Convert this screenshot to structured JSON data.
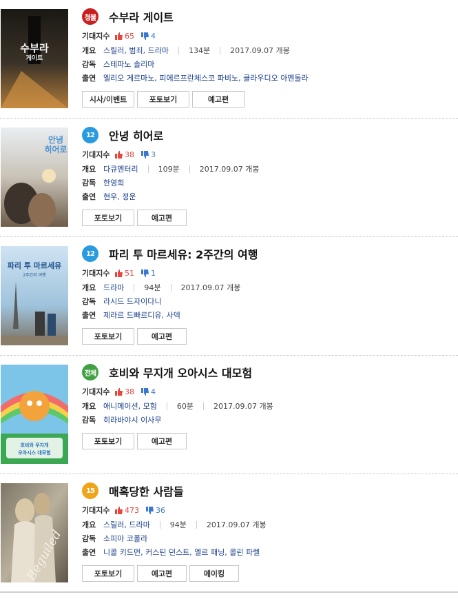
{
  "labels": {
    "expectation": "기대지수",
    "overview": "개요",
    "director": "감독",
    "cast": "출연"
  },
  "movies": [
    {
      "badge": "청불",
      "badge_color": "#c8201f",
      "title": "수부라 게이트",
      "likes": "65",
      "dislikes": "4",
      "genres": "스릴러, 범죄, 드라마",
      "runtime": "134분",
      "release": "2017.09.07 개봉",
      "director": "스테파노 솔리마",
      "cast": "엘리오 게르마노, 피에르프란체스코 파비노, 클라우디오 아멘돌라",
      "buttons": [
        "시사/이벤트",
        "포토보기",
        "예고편"
      ],
      "poster_title": "수부라\n게이트"
    },
    {
      "badge": "12",
      "badge_color": "#2a9be0",
      "title": "안녕 히어로",
      "likes": "38",
      "dislikes": "3",
      "genres": "다큐멘터리",
      "runtime": "109분",
      "release": "2017.09.07 개봉",
      "director": "한영희",
      "cast": "현우, 정운",
      "buttons": [
        "포토보기",
        "예고편"
      ],
      "poster_title": "안녕\n히어로"
    },
    {
      "badge": "12",
      "badge_color": "#2a9be0",
      "title": "파리 투 마르세유: 2주간의 여행",
      "likes": "51",
      "dislikes": "1",
      "genres": "드라마",
      "runtime": "94분",
      "release": "2017.09.07 개봉",
      "director": "라시드 드자이다니",
      "cast": "제라르 드빠르디유, 사덱",
      "buttons": [
        "포토보기",
        "예고편"
      ],
      "poster_title": "파리 투 마르세유"
    },
    {
      "badge": "전체",
      "badge_color": "#3fa142",
      "title": "호비와 무지개 오아시스 대모험",
      "likes": "38",
      "dislikes": "4",
      "genres": "애니메이션, 모험",
      "runtime": "60분",
      "release": "2017.09.07 개봉",
      "director": "히라바야시 이사무",
      "cast": null,
      "buttons": [
        "포토보기",
        "예고편"
      ],
      "poster_title": "호비와 무지개\n오아시스 대모험"
    },
    {
      "badge": "15",
      "badge_color": "#f0a419",
      "title": "매혹당한 사람들",
      "likes": "473",
      "dislikes": "36",
      "genres": "스릴러, 드라마",
      "runtime": "94분",
      "release": "2017.09.07 개봉",
      "director": "소피아 코폴라",
      "cast": "니콜 키드먼, 커스틴 던스트, 엘르 패닝, 콜린 파렐",
      "buttons": [
        "포토보기",
        "예고편",
        "메이킹"
      ],
      "poster_title": "Beguiled"
    }
  ]
}
